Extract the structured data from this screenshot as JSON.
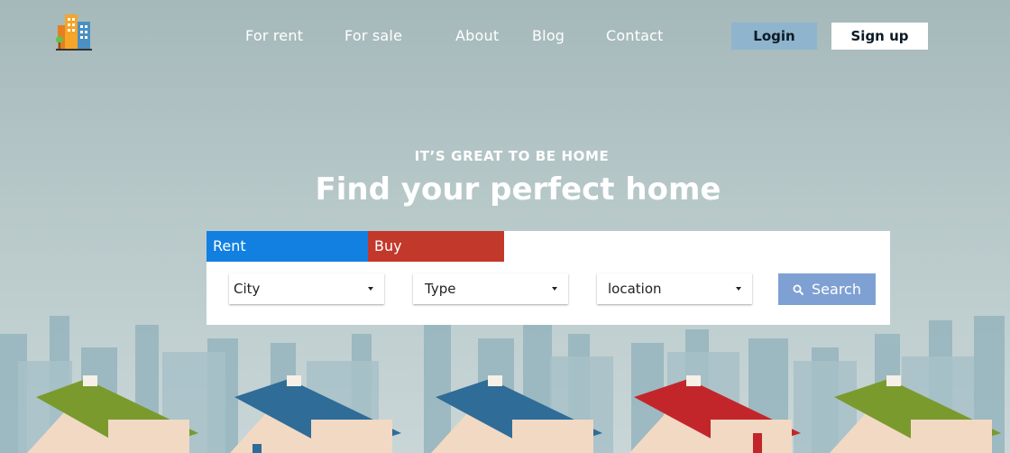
{
  "nav": {
    "links": [
      "For rent",
      "For sale",
      "About",
      "Blog",
      "Contact"
    ],
    "login": "Login",
    "signup": "Sign up"
  },
  "hero": {
    "eyebrow": "IT’S GREAT TO BE HOME",
    "headline": "Find your perfect home"
  },
  "search": {
    "tabs": [
      "Rent",
      "Buy"
    ],
    "filters": [
      "City",
      "Type",
      "location"
    ],
    "button": "Search"
  },
  "colors": {
    "rent_tab": "#1180e0",
    "buy_tab": "#c2382b",
    "login_bg": "#8fb4cd",
    "search_bg": "#7fa0d3"
  },
  "icons": [
    "buildings-logo-icon",
    "chevron-down-icon",
    "search-icon"
  ]
}
